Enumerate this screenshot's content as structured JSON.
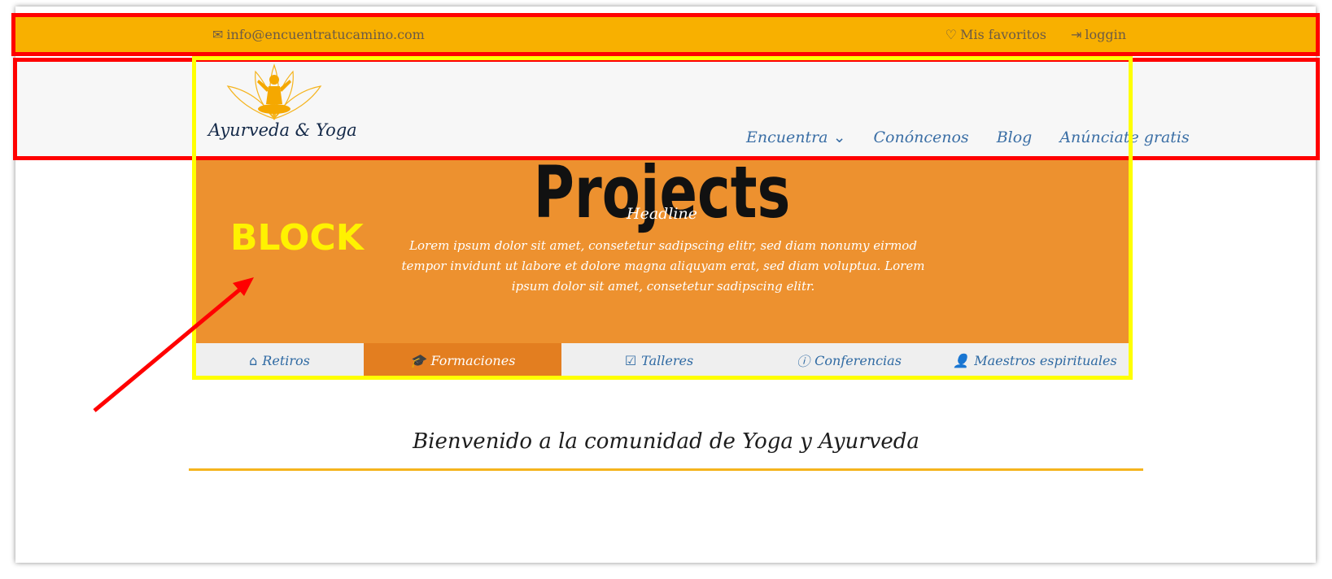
{
  "topbar": {
    "email": "info@encuentratucamino.com",
    "favorites_label": "Mis favoritos",
    "login_label": "loggin"
  },
  "header": {
    "logo_text": "Ayurveda & Yoga",
    "nav": [
      {
        "label": "Encuentra",
        "has_dropdown": true
      },
      {
        "label": "Conóncenos"
      },
      {
        "label": "Blog"
      },
      {
        "label": "Anúnciate gratis"
      }
    ]
  },
  "hero": {
    "title": "Projects",
    "block_label": "BLOCK",
    "headline": "Headline",
    "body": "Lorem ipsum dolor sit amet, consetetur sadipscing elitr, sed diam nonumy eirmod tempor invidunt ut labore et dolore magna aliquyam erat, sed diam voluptua. Lorem ipsum dolor sit amet, consetetur sadipscing elitr."
  },
  "tabs": [
    {
      "label": "Retiros",
      "icon": "home-icon",
      "active": false
    },
    {
      "label": "Formaciones",
      "icon": "graduation-cap-icon",
      "active": true
    },
    {
      "label": "Talleres",
      "icon": "edit-icon",
      "active": false
    },
    {
      "label": "Conferencias",
      "icon": "info-icon",
      "active": false
    },
    {
      "label": "Maestros espirituales",
      "icon": "user-icon",
      "active": false
    }
  ],
  "welcome": {
    "title": "Bienvenido a la comunidad de Yoga y Ayurveda"
  },
  "colors": {
    "topbar": "#f8b000",
    "hero": "#ed912f",
    "active_tab": "#e37e20",
    "nav_text": "#3a6ea5",
    "annotation_red": "#ff0000",
    "annotation_yellow": "#ffff00"
  }
}
